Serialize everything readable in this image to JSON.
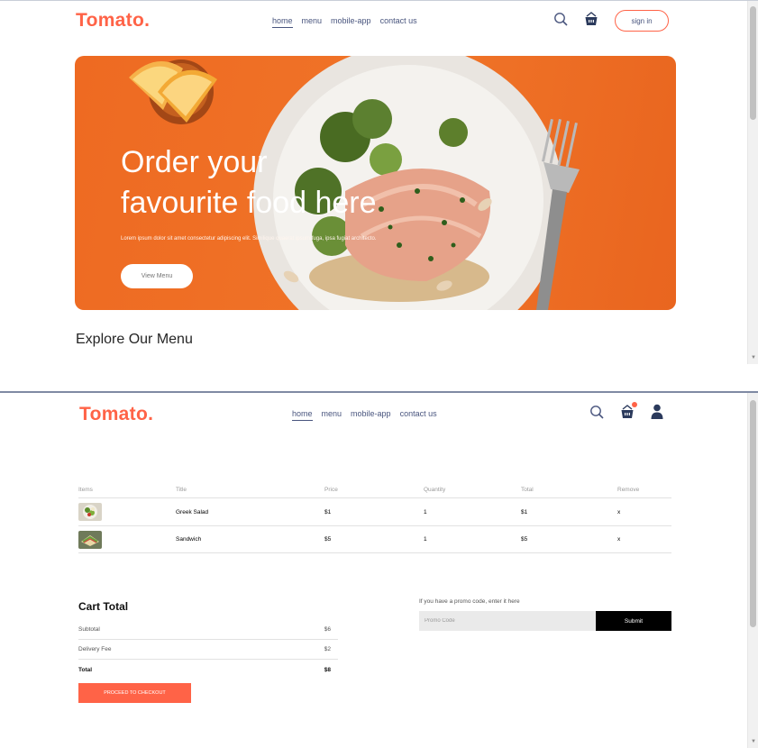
{
  "brand": {
    "logo": "Tomato.",
    "accent": "#ff6347",
    "text_color": "#49557e"
  },
  "nav": {
    "items": [
      {
        "label": "home",
        "active": true
      },
      {
        "label": "menu",
        "active": false
      },
      {
        "label": "mobile-app",
        "active": false
      },
      {
        "label": "contact us",
        "active": false
      }
    ],
    "icons": [
      "search-icon",
      "basket-icon",
      "user-icon"
    ],
    "signin_label": "sign in"
  },
  "hero": {
    "title_line1": "Order your",
    "title_line2": "favourite food here",
    "description": "Lorem ipsum dolor sit amet consectetur adipiscing elit. Similique quaerat ipsum fuga, ipsa fugiat architecto.",
    "button_label": "View Menu"
  },
  "explore": {
    "heading": "Explore Our Menu"
  },
  "cart": {
    "columns": [
      "Items",
      "Title",
      "Price",
      "Quantity",
      "Total",
      "Remove"
    ],
    "rows": [
      {
        "title": "Greek Salad",
        "price": "$1",
        "quantity": "1",
        "total": "$1",
        "remove": "x"
      },
      {
        "title": "Sandwich",
        "price": "$5",
        "quantity": "1",
        "total": "$5",
        "remove": "x"
      }
    ]
  },
  "totals": {
    "heading": "Cart Total",
    "subtotal_label": "Subtotal",
    "subtotal_value": "$6",
    "delivery_label": "Delivery Fee",
    "delivery_value": "$2",
    "total_label": "Total",
    "total_value": "$8",
    "checkout_label": "PROCEED TO CHECKOUT"
  },
  "promo": {
    "prompt": "If you have a promo code, enter it here",
    "placeholder": "Promo Code",
    "submit_label": "Submit"
  }
}
